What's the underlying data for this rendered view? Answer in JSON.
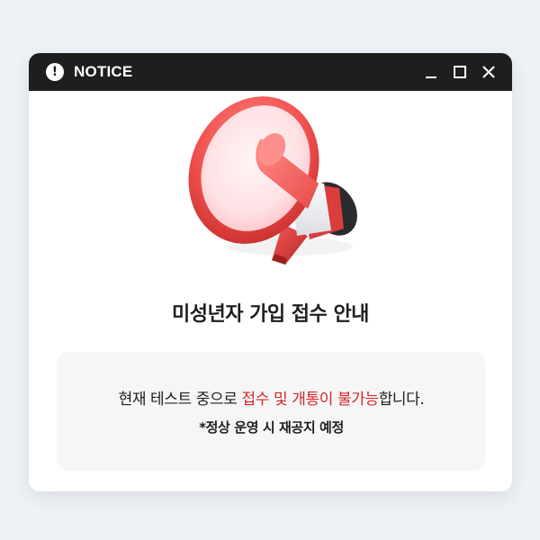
{
  "window": {
    "title": "NOTICE",
    "title_icon": "exclamation-circle-icon",
    "controls": {
      "minimize": "minimize-icon",
      "maximize": "maximize-icon",
      "close": "close-icon"
    }
  },
  "illustration": {
    "icon": "megaphone-icon",
    "colors": {
      "primary_red": "#e94b4b",
      "light_red": "#ff7b78",
      "inner_pink": "#ffe4e6"
    }
  },
  "heading": "미성년자 가입 접수 안내",
  "notice": {
    "line1_before": "현재 테스트 중으로 ",
    "line1_highlight": "접수 및 개통이 불가능",
    "line1_after": "합니다.",
    "line2": "*정상 운영 시 재공지 예정",
    "highlight_color": "#d6262c"
  }
}
